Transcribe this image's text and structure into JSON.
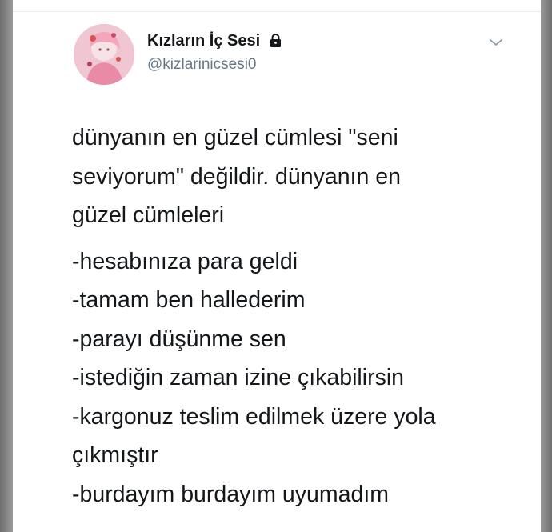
{
  "user": {
    "display_name": "Kızların İç Sesi",
    "handle": "@kizlarinicsesi0",
    "avatar_icon": "avatar-image",
    "protected_icon": "lock-icon",
    "menu_icon": "chevron-down-icon"
  },
  "tweet": {
    "paragraph_1": [
      "dünyanın en güzel cümlesi \"seni",
      "seviyorum\" değildir. dünyanın en",
      "güzel cümleleri"
    ],
    "paragraph_2": [
      "-hesabınıza para geldi",
      "-tamam ben hallederim",
      "-parayı düşünme sen",
      "-istediğin zaman izine çıkabilirsin",
      "-kargonuz teslim edilmek üzere yola",
      "çıkmıştır",
      "-burdayım burdayım uyumadım"
    ]
  },
  "colors": {
    "text": "#14171a",
    "secondary": "#657786",
    "background": "#ffffff",
    "frame": "#8a8a8a"
  }
}
